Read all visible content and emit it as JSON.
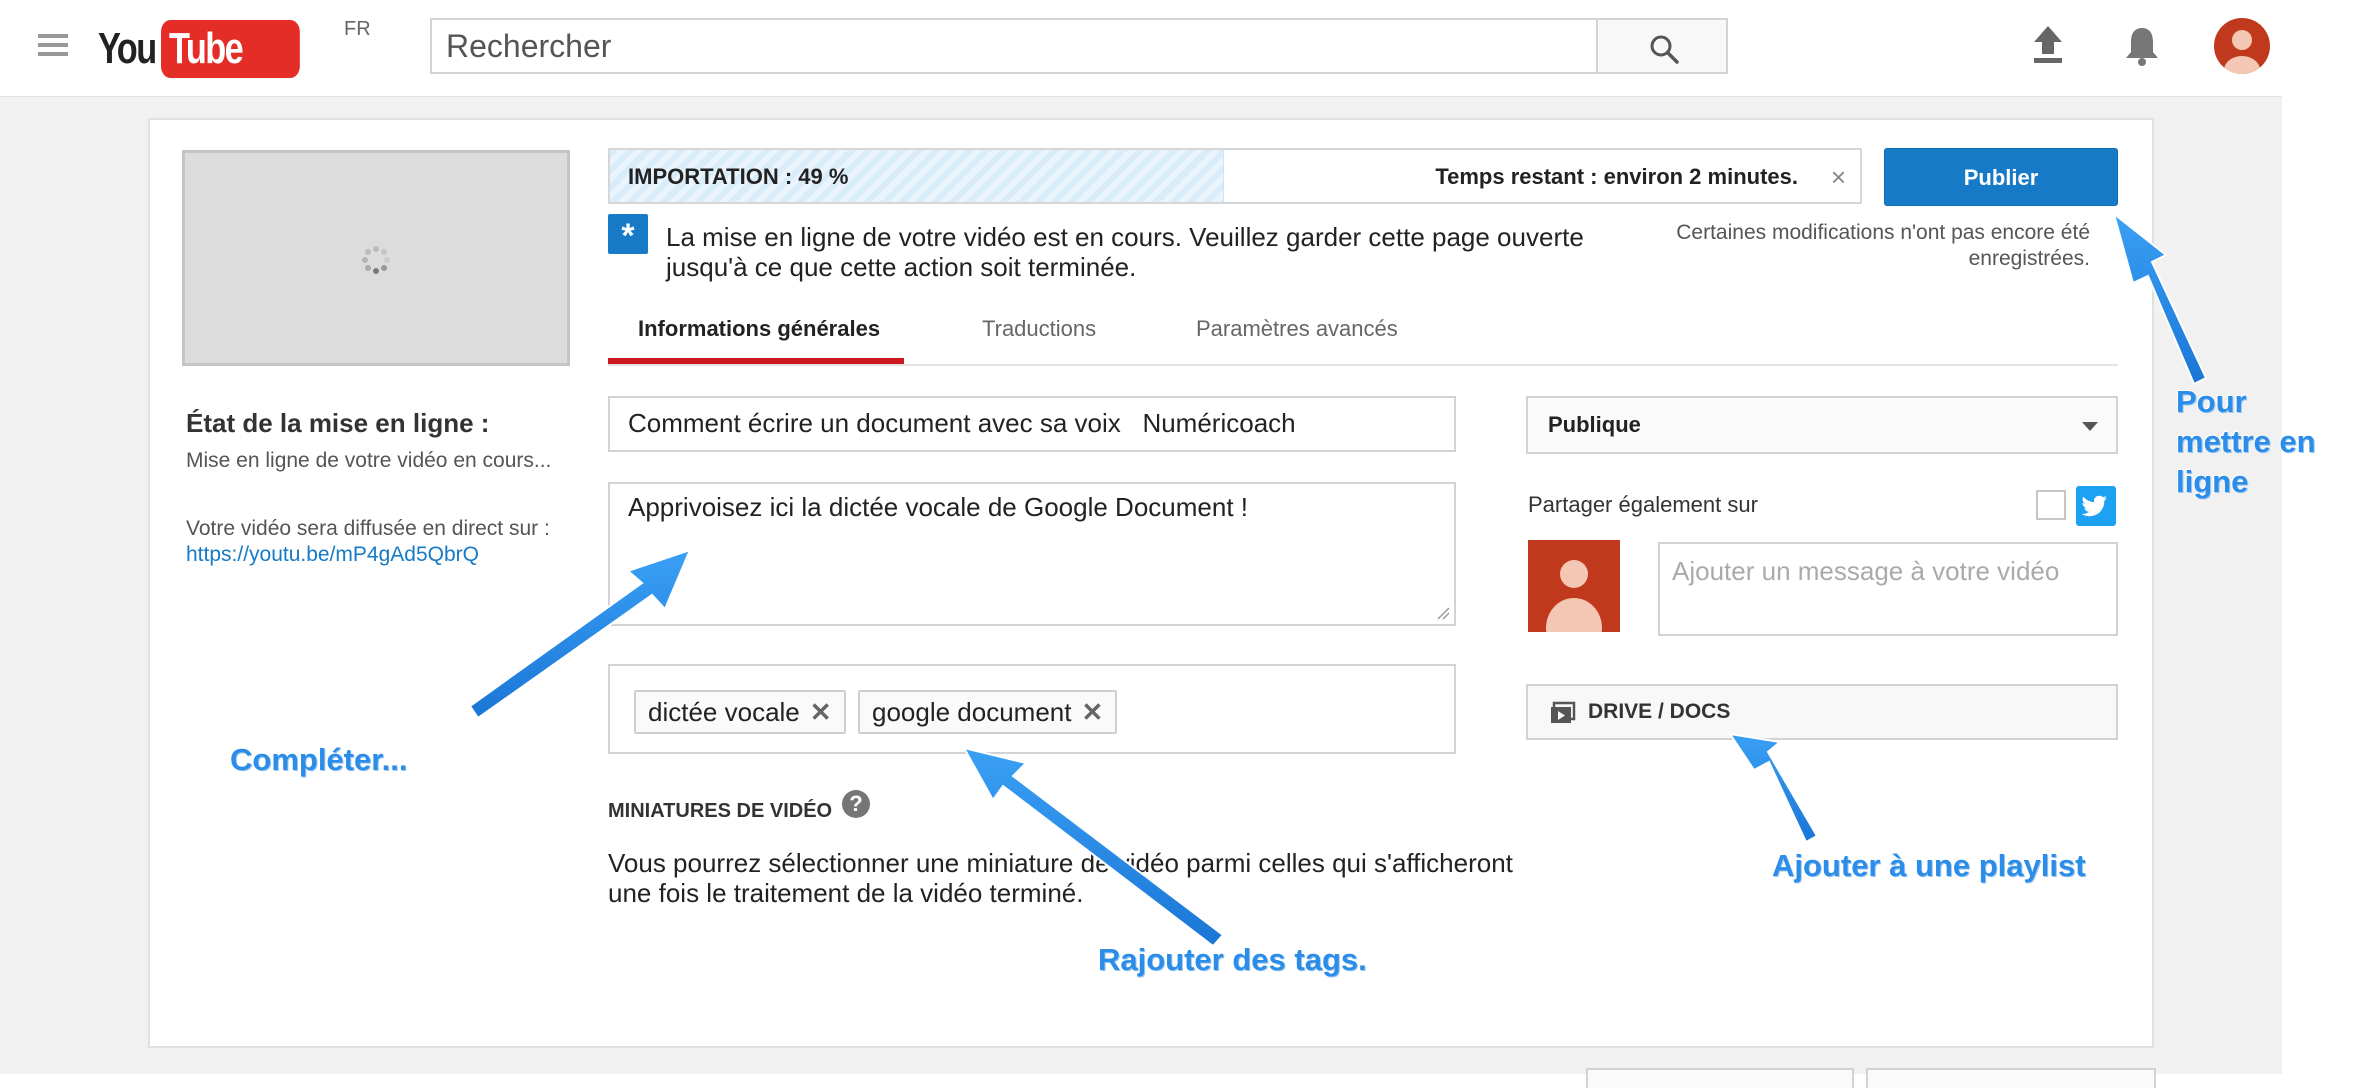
{
  "masthead": {
    "logo_you": "You",
    "logo_tube": "Tube",
    "region": "FR",
    "search_placeholder": "Rechercher"
  },
  "upload": {
    "status_title": "État de la mise en ligne :",
    "status_text": "Mise en ligne de votre vidéo en cours...",
    "direct_text": "Votre vidéo sera diffusée en direct sur :",
    "video_url": "https://youtu.be/mP4gAd5QbrQ",
    "progress_label": "IMPORTATION : 49 %",
    "progress_percent": 49,
    "time_remaining": "Temps restant : environ 2 minutes.",
    "close_glyph": "×",
    "info_message": "La mise en ligne de votre vidéo est en cours. Veuillez garder cette page ouverte jusqu'à ce que cette action soit terminée.",
    "publish_label": "Publier",
    "unsaved_note": "Certaines modifications n'ont pas encore été enregistrées."
  },
  "tabs": [
    {
      "label": "Informations générales",
      "active": true
    },
    {
      "label": "Traductions",
      "active": false
    },
    {
      "label": "Paramètres avancés",
      "active": false
    }
  ],
  "form": {
    "title_value": "Comment écrire un document avec sa voix   Numéricoach",
    "description_value": "Apprivoisez ici la dictée vocale de Google Document !",
    "tags": [
      "dictée vocale",
      "google document"
    ],
    "thumbnails_title": "MINIATURES DE VIDÉO",
    "thumbnails_text": "Vous pourrez sélectionner une miniature de vidéo parmi celles qui s'afficheront une fois le traitement de la vidéo terminé."
  },
  "sidebar": {
    "privacy_value": "Publique",
    "share_label": "Partager également sur",
    "message_placeholder": "Ajouter un message à votre vidéo",
    "playlist_label": "DRIVE / DOCS"
  },
  "annotations": {
    "complete": "Compléter...",
    "tags": "Rajouter des tags.",
    "playlist": "Ajouter à une playlist",
    "publish_line1": "Pour",
    "publish_line2": "mettre en",
    "publish_line3": "ligne"
  },
  "colors": {
    "accent": "#167ac6",
    "tab_underline": "#cc181e",
    "annotation": "#2b8de8",
    "logo_red": "#e52d27"
  }
}
